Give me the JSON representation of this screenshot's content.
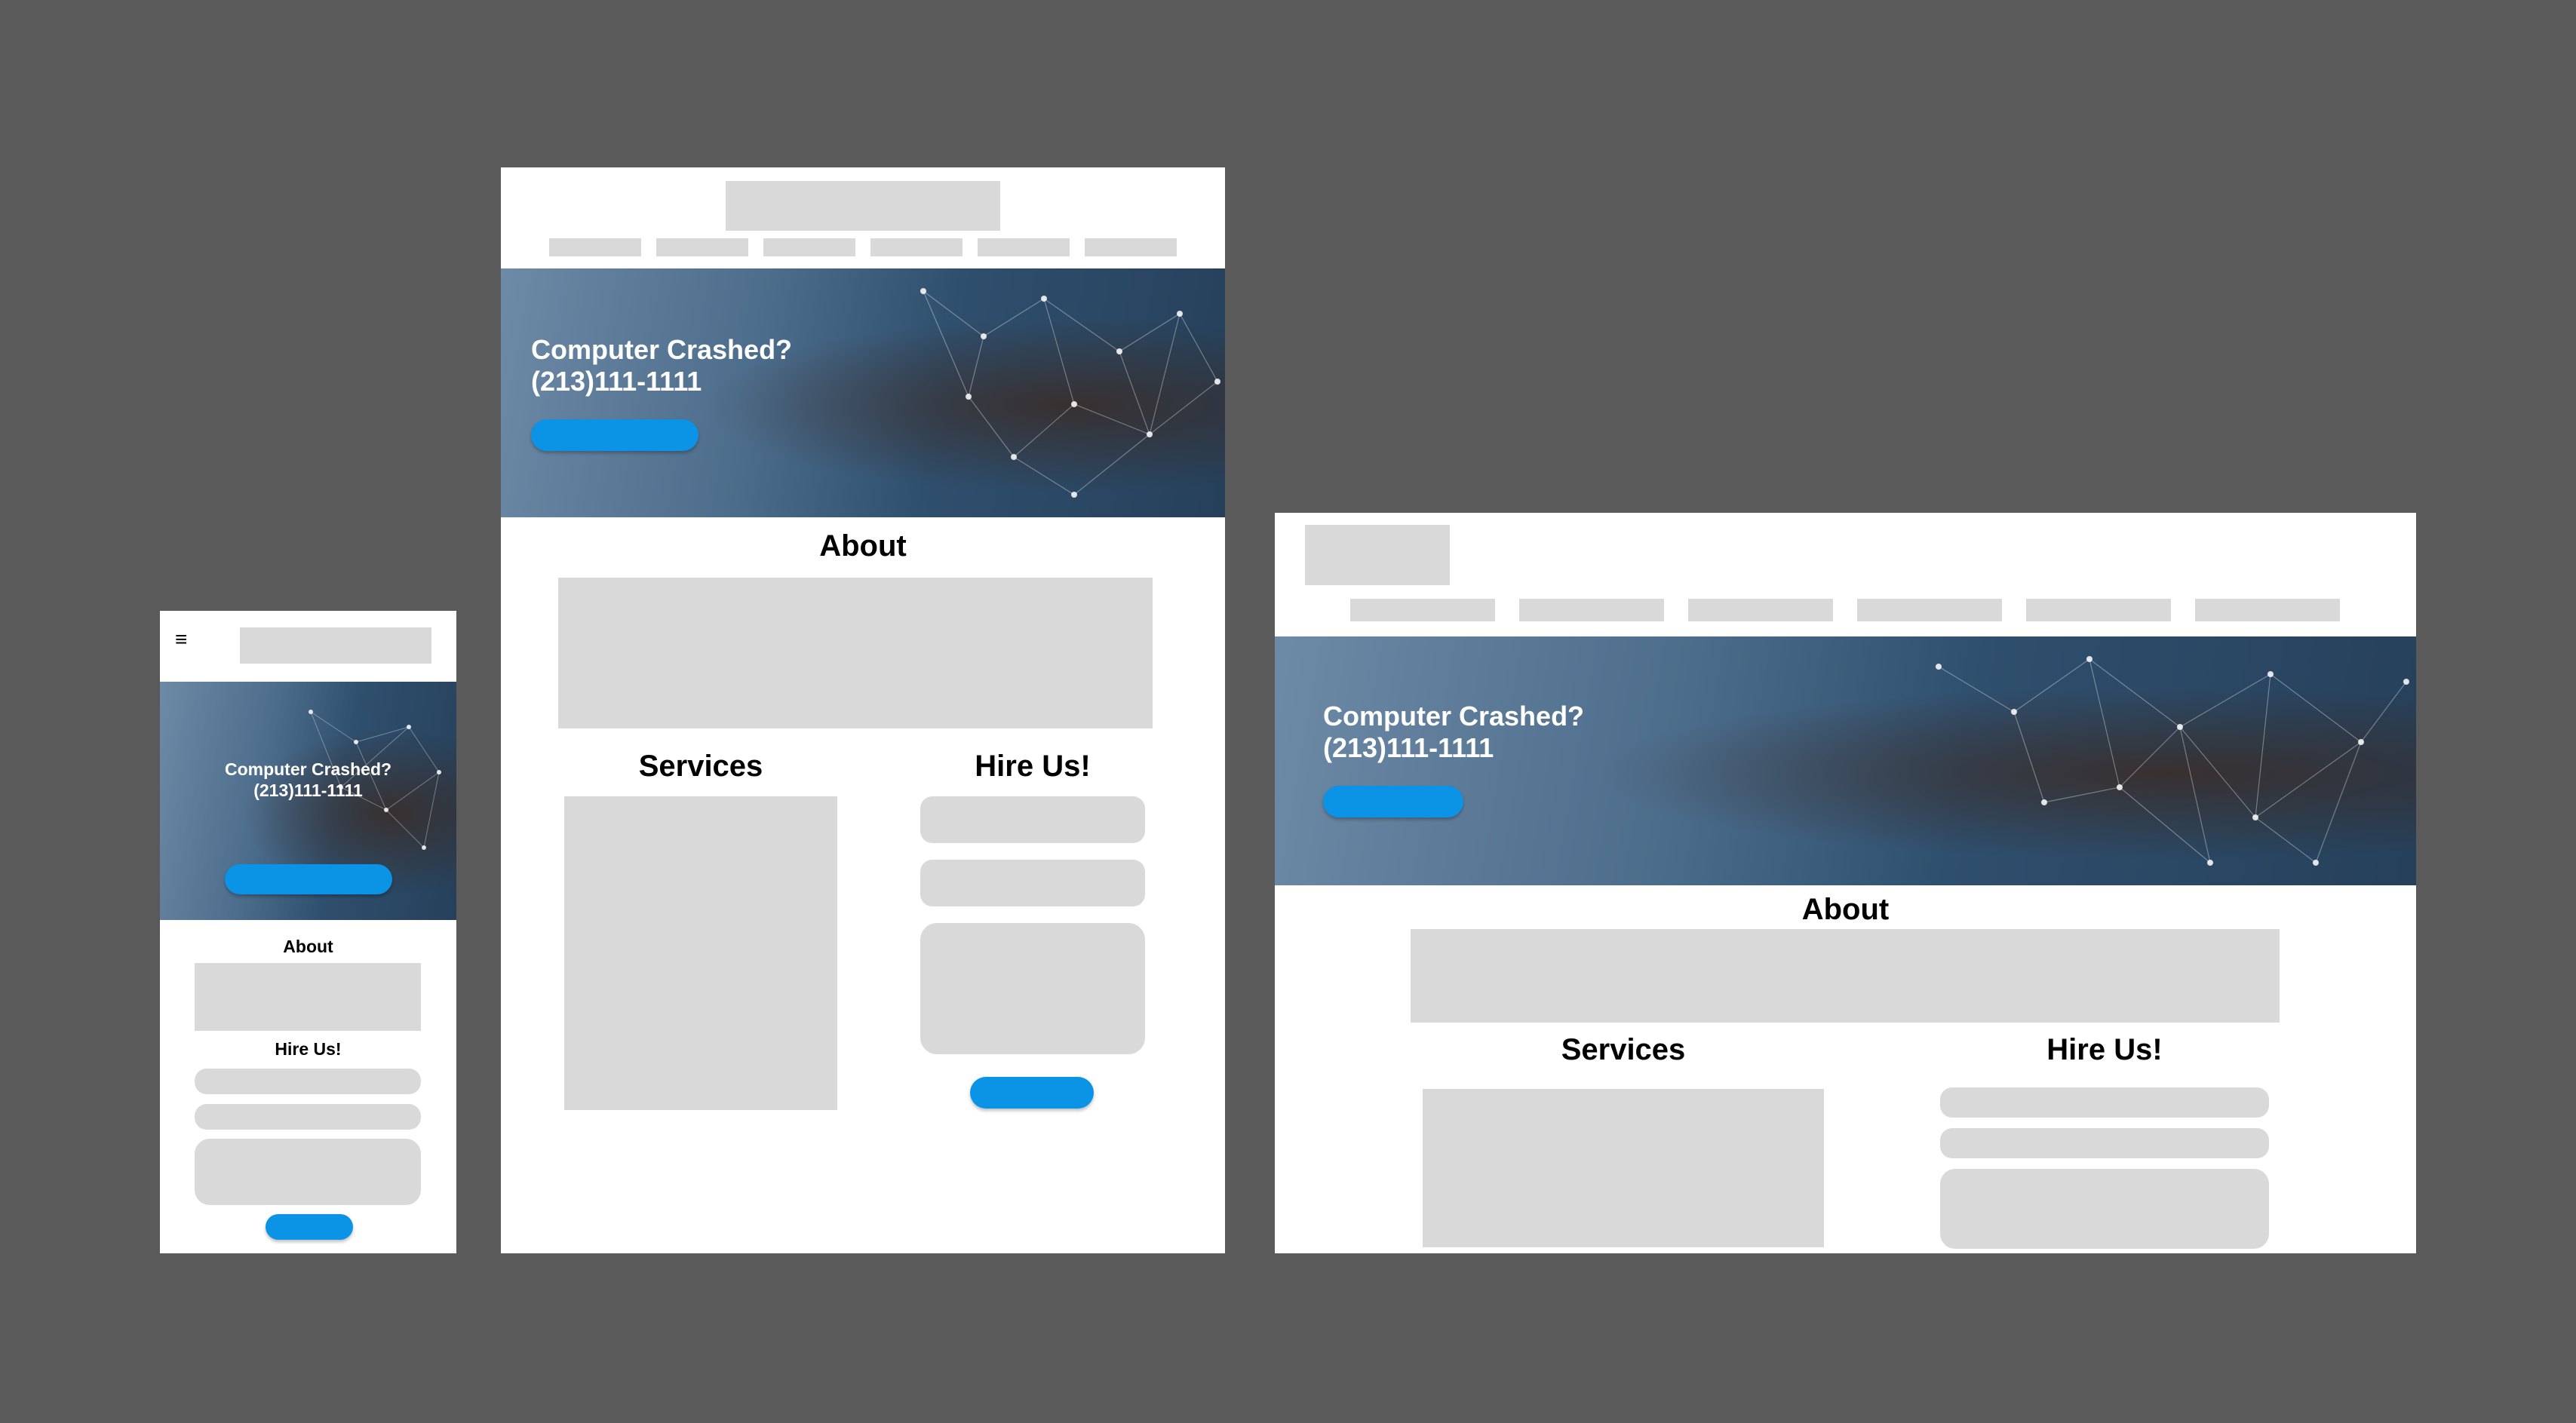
{
  "colors": {
    "background": "#5a5a5a",
    "frame": "#ffffff",
    "placeholder": "#d9d9d9",
    "accent_button": "#0b93e6"
  },
  "mobile": {
    "menu_icon": "hamburger-icon",
    "menu_glyph": "≡",
    "hero": {
      "headline": "Computer Crashed?",
      "phone": "(213)111-1111"
    },
    "about_heading": "About",
    "hire_heading": "Hire Us!"
  },
  "tablet": {
    "hero": {
      "headline": "Computer Crashed?",
      "phone": "(213)111-1111"
    },
    "about_heading": "About",
    "services_heading": "Services",
    "hire_heading": "Hire Us!"
  },
  "desktop": {
    "hero": {
      "headline": "Computer Crashed?",
      "phone": "(213)111-1111"
    },
    "about_heading": "About",
    "services_heading": "Services",
    "hire_heading": "Hire Us!"
  }
}
